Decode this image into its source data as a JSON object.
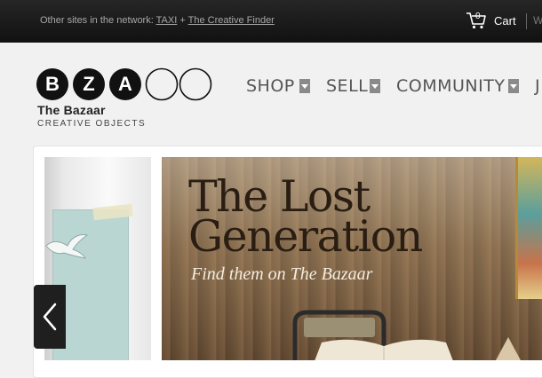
{
  "topbar": {
    "network_prefix": "Other sites in the network:",
    "links": [
      "TAXI",
      "The Creative Finder"
    ],
    "separator": "+",
    "cart_count": "0",
    "cart_label": "Cart",
    "next_item": "W"
  },
  "logo": {
    "letters": [
      "B",
      "Z",
      "A"
    ],
    "name": "The Bazaar",
    "tagline": "CREATIVE OBJECTS"
  },
  "nav": {
    "items": [
      {
        "label": "SHOP"
      },
      {
        "label": "SELL"
      },
      {
        "label": "COMMUNITY"
      },
      {
        "label": "J"
      }
    ]
  },
  "hero": {
    "title_line1": "The Lost",
    "title_line2": "Generation",
    "subtitle": "Find them on The Bazaar"
  },
  "colors": {
    "topbar_bg": "#1a1a1a",
    "page_bg": "#f1f1f1",
    "nav_text": "#555555",
    "caret_bg": "#8a8a8a"
  },
  "icons": {
    "cart": "cart-icon",
    "prev": "chevron-left-icon",
    "nav_caret": "chevron-down-icon"
  }
}
